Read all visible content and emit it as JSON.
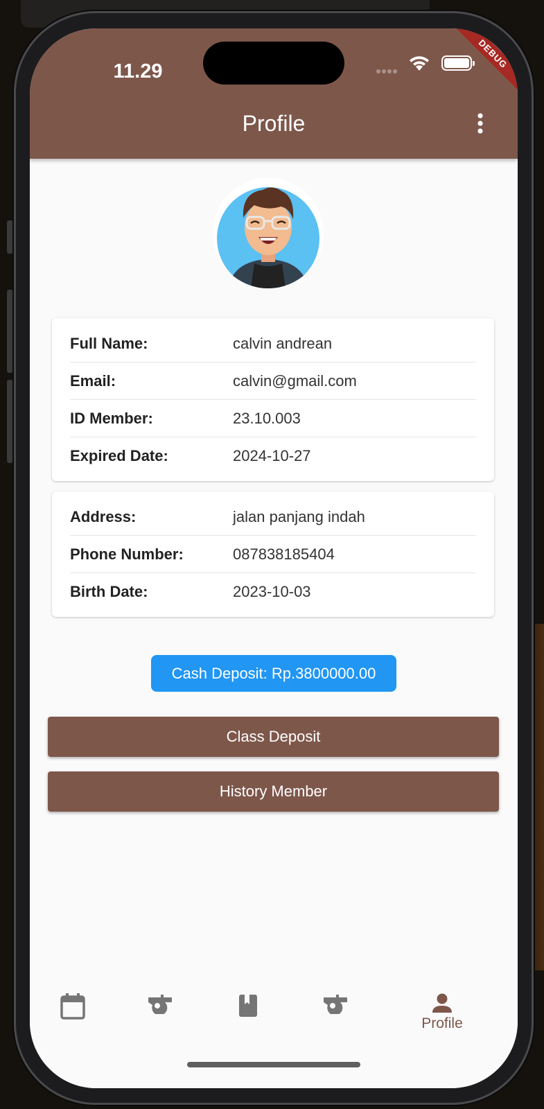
{
  "status_bar": {
    "time": "11.29",
    "debug_banner": "DEBUG"
  },
  "app_bar": {
    "title": "Profile",
    "more_icon": "more-vert-icon"
  },
  "profile_card": [
    {
      "label": "Full Name:",
      "value": "calvin andrean"
    },
    {
      "label": "Email:",
      "value": "calvin@gmail.com"
    },
    {
      "label": "ID Member:",
      "value": "23.10.003"
    },
    {
      "label": "Expired Date:",
      "value": "2024-10-27"
    }
  ],
  "contact_card": [
    {
      "label": "Address:",
      "value": "jalan panjang indah"
    },
    {
      "label": "Phone Number:",
      "value": "087838185404"
    },
    {
      "label": "Birth Date:",
      "value": "2023-10-03"
    }
  ],
  "cash_deposit": "Cash Deposit: Rp.3800000.00",
  "buttons": {
    "class_deposit": "Class Deposit",
    "history_member": "History Member"
  },
  "bottom_nav": [
    {
      "icon": "calendar-icon",
      "label": ""
    },
    {
      "icon": "whistle-icon",
      "label": ""
    },
    {
      "icon": "book-icon",
      "label": ""
    },
    {
      "icon": "whistle-icon",
      "label": ""
    },
    {
      "icon": "person-icon",
      "label": "Profile",
      "active": true
    }
  ],
  "colors": {
    "primary": "#7e574b",
    "accent": "#2196f3",
    "inactive_icon": "#757575"
  }
}
